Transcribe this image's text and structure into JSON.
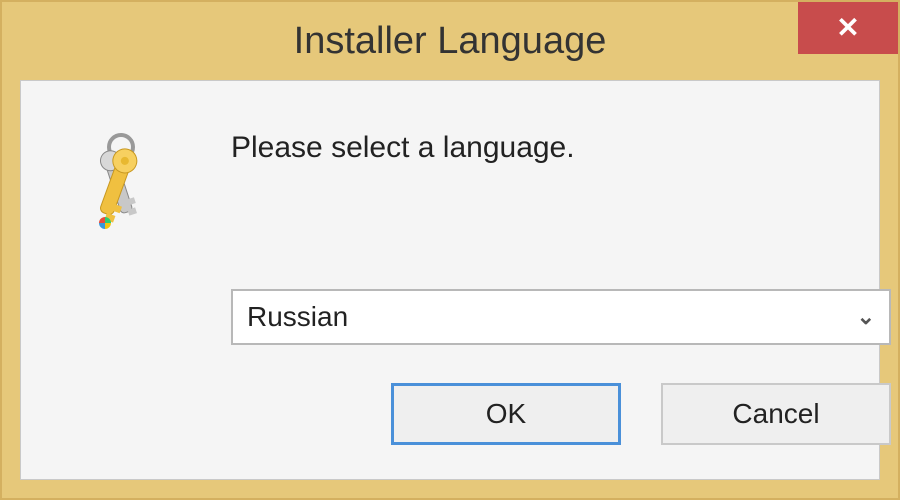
{
  "window": {
    "title": "Installer Language"
  },
  "dialog": {
    "prompt": "Please select a language.",
    "language": {
      "selected": "Russian"
    },
    "buttons": {
      "ok": "OK",
      "cancel": "Cancel"
    }
  }
}
